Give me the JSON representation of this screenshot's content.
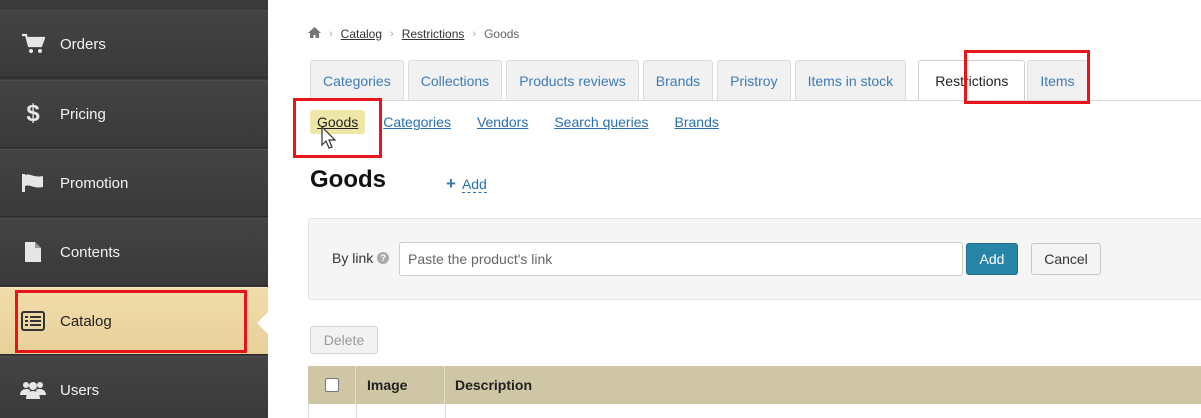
{
  "sidebar": {
    "items": [
      {
        "label": "Orders",
        "icon": "cart-icon"
      },
      {
        "label": "Pricing",
        "icon": "dollar-icon"
      },
      {
        "label": "Promotion",
        "icon": "flag-icon"
      },
      {
        "label": "Contents",
        "icon": "document-icon"
      },
      {
        "label": "Catalog",
        "icon": "list-icon",
        "active": true
      },
      {
        "label": "Users",
        "icon": "users-icon"
      }
    ]
  },
  "breadcrumb": {
    "home_icon": "home-icon",
    "items": [
      "Catalog",
      "Restrictions",
      "Goods"
    ]
  },
  "tabs": [
    {
      "label": "Categories"
    },
    {
      "label": "Collections"
    },
    {
      "label": "Products reviews"
    },
    {
      "label": "Brands"
    },
    {
      "label": "Pristroy"
    },
    {
      "label": "Items in stock"
    },
    {
      "label": "Restrictions",
      "active": true
    },
    {
      "label": "Items"
    }
  ],
  "subnav": [
    {
      "label": "Goods",
      "active": true
    },
    {
      "label": "Categories"
    },
    {
      "label": "Vendors"
    },
    {
      "label": "Search queries"
    },
    {
      "label": "Brands"
    }
  ],
  "page": {
    "title": "Goods",
    "add_label": "Add"
  },
  "form": {
    "by_link_label": "By link",
    "link_placeholder": "Paste the product's link",
    "add_button": "Add",
    "cancel_button": "Cancel"
  },
  "delete_button": "Delete",
  "table": {
    "columns": [
      "Image",
      "Description"
    ]
  },
  "colors": {
    "highlight": "#e8141b",
    "active_sidebar": "#ecd6a2",
    "table_header": "#cfc6a5",
    "primary_button": "#2786a8",
    "link": "#2a6fb0"
  }
}
